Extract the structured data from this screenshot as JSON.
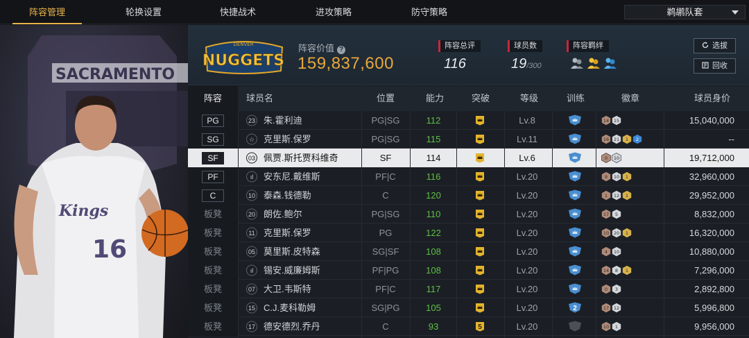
{
  "nav": {
    "tabs": [
      {
        "label": "阵容管理",
        "active": true
      },
      {
        "label": "轮换设置",
        "active": false
      },
      {
        "label": "快捷战术",
        "active": false
      },
      {
        "label": "进攻策略",
        "active": false
      },
      {
        "label": "防守策略",
        "active": false
      }
    ],
    "team_select": "鹈鹕队套"
  },
  "summary": {
    "logo_text": "NUGGETS",
    "logo_sub": "DENVER",
    "value_label": "阵容价值",
    "value": "159,837,600",
    "rating_label": "阵容总评",
    "rating": "116",
    "players_label": "球员数",
    "players": "19",
    "players_max": "/300",
    "bond_label": "阵容羁绊",
    "select_btn": "选拔",
    "recycle_btn": "回收"
  },
  "player_panel": {
    "jersey_team": "Kings",
    "jersey_number": "16",
    "backdrop_text": "SACRAMENTO"
  },
  "table": {
    "headers": {
      "lineup": "阵容",
      "name": "球员名",
      "position": "位置",
      "ability": "能力",
      "breakthrough": "突破",
      "level": "等级",
      "training": "训练",
      "badges": "徽章",
      "salary": "球员身价"
    },
    "rows": [
      {
        "slot": "PG",
        "starter": true,
        "no": "23",
        "name": "朱.霍利迪",
        "pos": "PG|SG",
        "ability": "112",
        "lv": "Lv.8",
        "badges": [
          "14",
          "15"
        ],
        "salary": "15,040,000"
      },
      {
        "slot": "SG",
        "starter": true,
        "no": "☆",
        "name": "克里斯.保罗",
        "pos": "PG|SG",
        "ability": "115",
        "lv": "Lv.11",
        "badges": [
          "16",
          "21",
          "1",
          "2"
        ],
        "salary": "--"
      },
      {
        "slot": "SF",
        "starter": true,
        "no": "03",
        "name": "佩贾.斯托贾科维奇",
        "pos": "SF",
        "ability": "114",
        "lv": "Lv.6",
        "badges": [
          "0",
          "10"
        ],
        "salary": "19,712,000",
        "selected": true
      },
      {
        "slot": "PF",
        "starter": true,
        "no": "ıl",
        "name": "安东尼.戴维斯",
        "pos": "PF|C",
        "ability": "116",
        "lv": "Lv.20",
        "badges": [
          "9",
          "10",
          "1"
        ],
        "salary": "32,960,000"
      },
      {
        "slot": "C",
        "starter": true,
        "no": "10",
        "name": "泰森.钱德勒",
        "pos": "C",
        "ability": "120",
        "lv": "Lv.20",
        "badges": [
          "1",
          "12",
          "1"
        ],
        "salary": "29,952,000"
      },
      {
        "slot": "板凳",
        "starter": false,
        "no": "20",
        "name": "朗佐.鲍尔",
        "pos": "PG|SG",
        "ability": "110",
        "lv": "Lv.20",
        "badges": [
          "17",
          "5"
        ],
        "salary": "8,832,000"
      },
      {
        "slot": "板凳",
        "starter": false,
        "no": "11",
        "name": "克里斯.保罗",
        "pos": "PG",
        "ability": "122",
        "lv": "Lv.20",
        "badges": [
          "10",
          "20",
          "1"
        ],
        "salary": "16,320,000"
      },
      {
        "slot": "板凳",
        "starter": false,
        "no": "05",
        "name": "莫里斯.皮特森",
        "pos": "SG|SF",
        "ability": "108",
        "lv": "Lv.20",
        "badges": [
          "4",
          "10"
        ],
        "salary": "10,880,000"
      },
      {
        "slot": "板凳",
        "starter": false,
        "no": "ıl",
        "name": "锡安.威廉姆斯",
        "pos": "PF|PG",
        "ability": "108",
        "lv": "Lv.20",
        "badges": [
          "14",
          "8",
          "1"
        ],
        "salary": "7,296,000"
      },
      {
        "slot": "板凳",
        "starter": false,
        "no": "07",
        "name": "大卫.韦斯特",
        "pos": "PF|C",
        "ability": "117",
        "lv": "Lv.20",
        "badges": [
          "0",
          "3"
        ],
        "salary": "2,892,800"
      },
      {
        "slot": "板凳",
        "starter": false,
        "no": "15",
        "name": "C.J.麦科勒姆",
        "pos": "SG|PG",
        "ability": "105",
        "lv": "Lv.20",
        "badges": [
          "17",
          "12"
        ],
        "salary": "5,996,800",
        "train": "2"
      },
      {
        "slot": "板凳",
        "starter": false,
        "no": "17",
        "name": "德安德烈.乔丹",
        "pos": "C",
        "ability": "93",
        "lv": "Lv.20",
        "badges": [
          "10",
          "1"
        ],
        "salary": "9,956,000",
        "brk": "5"
      }
    ]
  },
  "colors": {
    "accent": "#e8b34a",
    "value_gold": "#e8a83a",
    "ability_green": "#5fbf45",
    "stat_red": "#c8273a"
  }
}
